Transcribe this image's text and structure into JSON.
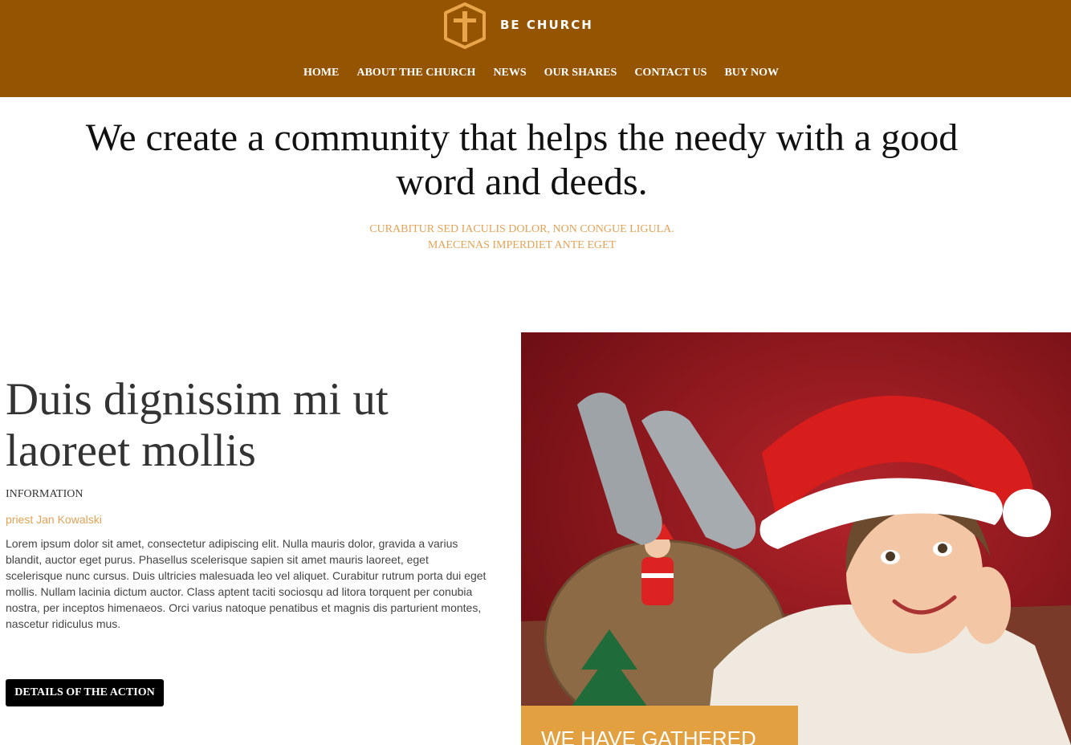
{
  "header": {
    "brand": "BE CHURCH",
    "logo_icon": "cross-shield-icon",
    "nav": [
      "HOME",
      "ABOUT THE CHURCH",
      "NEWS",
      "OUR SHARES",
      "CONTACT US",
      "BUY NOW"
    ]
  },
  "hero": {
    "title": "We create a community that helps the needy with a good word and deeds.",
    "subtitle_line1": "CURABITUR SED IACULIS DOLOR, NON CONGUE LIGULA.",
    "subtitle_line2": "MAECENAS IMPERDIET ANTE EGET"
  },
  "article": {
    "title": "Duis dignissim mi ut laoreet mollis",
    "label": "INFORMATION",
    "author": "priest Jan Kowalski",
    "body": "Lorem ipsum dolor sit amet, consectetur adipiscing elit. Nulla mauris dolor, gravida a varius blandit, auctor eget purus. Phasellus scelerisque sapien sit amet mauris laoreet, eget scelerisque nunc cursus. Duis ultricies malesuada leo vel aliquet. Curabitur rutrum porta dui eget mollis. Nullam lacinia dictum auctor. Class aptent taciti sociosqu ad litora torquent per conubia nostra, per inceptos himenaeos. Orci varius natoque penatibus et magnis dis parturient montes, nascetur ridiculus mus.",
    "button": "DETAILS OF THE ACTION"
  },
  "feature": {
    "image_alt": "child in santa hat",
    "callout": "WE HAVE GATHERED"
  },
  "colors": {
    "header_bg": "#945402",
    "accent": "#e3a255",
    "callout_bg": "#e3a040",
    "button_bg": "#000000"
  }
}
